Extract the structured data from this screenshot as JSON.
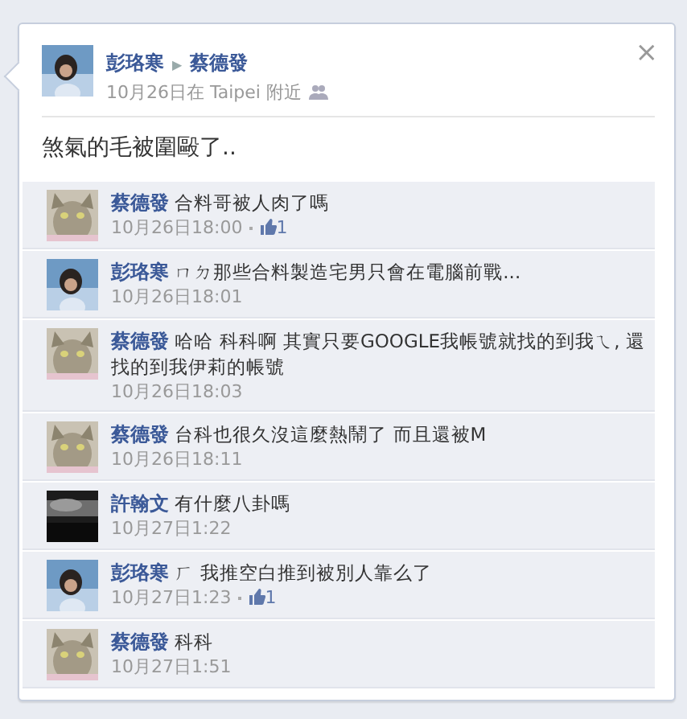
{
  "post": {
    "author": "彭珞寒",
    "target": "蔡德發",
    "separator": "▶",
    "time": "10月26日在 Taipei 附近",
    "close": "×",
    "text": "煞氣的毛被圍毆了.."
  },
  "comments": [
    {
      "author": "蔡德發",
      "text": "合料哥被人肉了嗎",
      "time": "10月26日18:00",
      "likes": "1"
    },
    {
      "author": "彭珞寒",
      "text": "ㄇㄉ那些合料製造宅男只會在電腦前戰...",
      "time": "10月26日18:01"
    },
    {
      "author": "蔡德發",
      "text": "哈哈 科科啊 其實只要GOOGLE我帳號就找的到我ㄟ, 還找的到我伊莉的帳號",
      "time": "10月26日18:03"
    },
    {
      "author": "蔡德發",
      "text": "台科也很久沒這麼熱鬧了 而且還被M",
      "time": "10月26日18:11"
    },
    {
      "author": "許翰文",
      "text": "有什麼八卦嗎",
      "time": "10月27日1:22"
    },
    {
      "author": "彭珞寒",
      "text": "ㄏ 我推空白推到被別人靠么了",
      "time": "10月27日1:23",
      "likes": "1"
    },
    {
      "author": "蔡德發",
      "text": "科科",
      "time": "10月27日1:51"
    }
  ]
}
